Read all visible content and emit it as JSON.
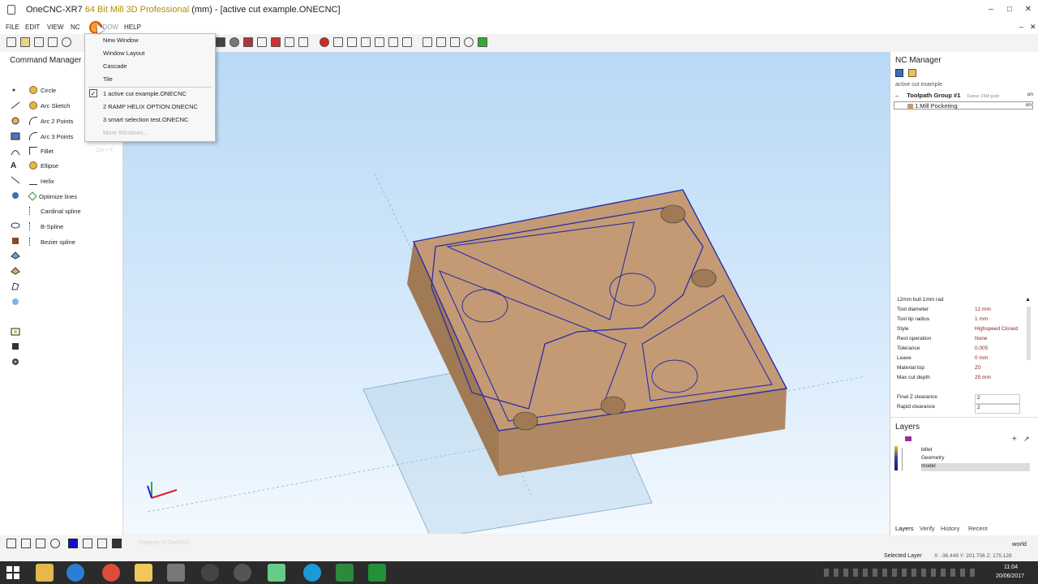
{
  "titlebar": {
    "app": "OneCNC-XR7",
    "edition": "64 Bit Mill 3D Professional",
    "rest": " (mm) - [active cut example.ONECNC]"
  },
  "menu": {
    "file": "FILE",
    "edit": "EDIT",
    "view": "VIEW",
    "nc": "NC",
    "window": "WINDOW",
    "help": "HELP"
  },
  "window_menu": {
    "new_window": "New Window",
    "window_layout": "Window Layout",
    "cascade": "Cascade",
    "tile": "Tile",
    "files": [
      "1 active cut example.ONECNC",
      "2 RAMP HELIX OPTION.ONECNC",
      "3 smart selection test.ONECNC"
    ],
    "more": "More Windows..."
  },
  "command_manager": {
    "title": "Command Manager",
    "items": [
      "Circle",
      "Arc Sketch",
      "Arc 2 Points",
      "Arc 3 Points",
      "Fillet",
      "Ellipse",
      "Helix",
      "Optimize lines",
      "Cardinal spline",
      "B-Spline",
      "Bezier spline"
    ],
    "shortcut": "Ctrl + F"
  },
  "nc_manager": {
    "title": "NC Manager",
    "file": "active cut example",
    "group": "Toolpath Group #1",
    "post": "Fanuc 15M post",
    "op": "1:Mill Pocketing",
    "on": "on"
  },
  "tool_props": {
    "tool": "12mm bull 1mm rad",
    "rows": [
      {
        "k": "Tool diameter",
        "v": "12 mm"
      },
      {
        "k": "Tool tip radius",
        "v": "1 mm"
      },
      {
        "k": "Style",
        "v": "Highspeed Closed"
      },
      {
        "k": "Rest operation",
        "v": "None"
      },
      {
        "k": "Tolerance",
        "v": "0.005"
      },
      {
        "k": "Leave",
        "v": "0 mm"
      },
      {
        "k": "Material top",
        "v": "Z0"
      },
      {
        "k": "Max cut depth",
        "v": "25 mm"
      }
    ],
    "final_z": {
      "k": "Final Z clearance",
      "v": "2"
    },
    "rapid": {
      "k": "Rapid clearance",
      "v": "2"
    }
  },
  "layers": {
    "title": "Layers",
    "items": [
      "billet",
      "Geometry",
      "model"
    ],
    "tabs": [
      "Layers",
      "Verify",
      "History",
      "Recent"
    ]
  },
  "status": {
    "view": "world",
    "selected_layer": "Selected Layer",
    "coords": "X: -36.449   Y: 201.706   Z: 175.128",
    "watermark": "Property of OneCNC"
  },
  "clock": {
    "time": "11:04",
    "date": "20/06/2017"
  },
  "colors": {
    "part": "#c39a74",
    "toolpath": "#2c2ca8",
    "viewport_top": "#b9d9f5",
    "taskbar": "#2b2b2b"
  }
}
